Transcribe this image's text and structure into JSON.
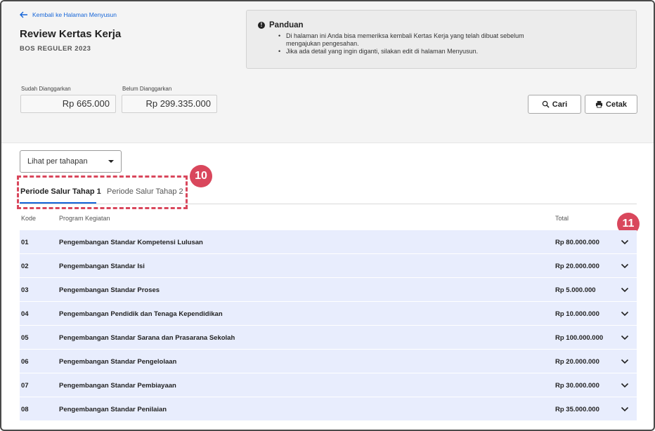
{
  "header": {
    "back_link": "Kembali ke Halaman Menyusun",
    "title": "Review Kertas Kerja",
    "subtitle": "BOS REGULER 2023"
  },
  "guide": {
    "title": "Panduan",
    "items": [
      "Di halaman ini Anda bisa memeriksa kembali Kertas Kerja yang telah dibuat sebelum mengajukan pengesahan.",
      "Jika ada detail yang ingin diganti, silakan edit di halaman Menyusun."
    ]
  },
  "budget": {
    "allocated_label": "Sudah Dianggarkan",
    "allocated_value": "Rp 665.000",
    "unallocated_label": "Belum Dianggarkan",
    "unallocated_value": "Rp 299.335.000"
  },
  "toolbar": {
    "search_label": "Cari",
    "print_label": "Cetak"
  },
  "filter": {
    "selected": "Lihat per tahapan"
  },
  "tabs": [
    {
      "label": "Periode Salur Tahap 1"
    },
    {
      "label": "Periode Salur Tahap 2"
    }
  ],
  "annotations": {
    "marker_tabs": "10",
    "marker_expand": "11"
  },
  "table": {
    "headers": {
      "code": "Kode",
      "program": "Program Kegiatan",
      "total": "Total"
    },
    "rows": [
      {
        "code": "01",
        "program": "Pengembangan Standar Kompetensi Lulusan",
        "total": "Rp 80.000.000"
      },
      {
        "code": "02",
        "program": "Pengembangan Standar Isi",
        "total": "Rp 20.000.000"
      },
      {
        "code": "03",
        "program": "Pengembangan Standar Proses",
        "total": "Rp 5.000.000"
      },
      {
        "code": "04",
        "program": "Pengembangan Pendidik dan Tenaga Kependidikan",
        "total": "Rp 10.000.000"
      },
      {
        "code": "05",
        "program": "Pengembangan Standar Sarana dan Prasarana Sekolah",
        "total": "Rp 100.000.000"
      },
      {
        "code": "06",
        "program": "Pengembangan Standar Pengelolaan",
        "total": "Rp 20.000.000"
      },
      {
        "code": "07",
        "program": "Pengembangan Standar Pembiayaan",
        "total": "Rp 30.000.000"
      },
      {
        "code": "08",
        "program": "Pengembangan Standar Penilaian",
        "total": "Rp 35.000.000"
      }
    ]
  },
  "colors": {
    "accent": "#1565d8",
    "marker": "#d9475c",
    "row_bg": "#e8edfd"
  }
}
